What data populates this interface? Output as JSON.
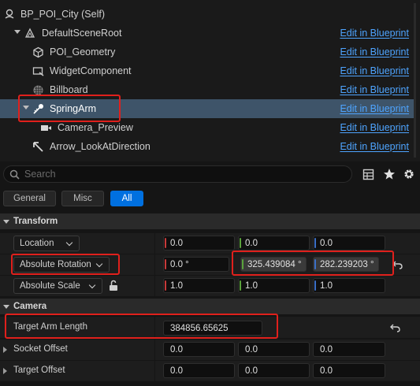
{
  "tree": {
    "root": "BP_POI_City (Self)",
    "edit_label": "Edit in Blueprint",
    "items": [
      {
        "label": "DefaultSceneRoot",
        "edit": "Edit in Blueprint"
      },
      {
        "label": "POI_Geometry",
        "edit": "Edit in Blueprint"
      },
      {
        "label": "WidgetComponent",
        "edit": "Edit in Blueprint"
      },
      {
        "label": "Billboard",
        "edit": "Edit in Blueprint"
      },
      {
        "label": "SpringArm",
        "edit": "Edit in Blueprint"
      },
      {
        "label": "Camera_Preview",
        "edit": "Edit in Blueprint"
      },
      {
        "label": "Arrow_LookAtDirection",
        "edit": "Edit in Blueprint"
      }
    ]
  },
  "search": {
    "placeholder": "Search"
  },
  "filters": {
    "general": "General",
    "misc": "Misc",
    "all": "All",
    "active": "All"
  },
  "transform": {
    "title": "Transform",
    "location": {
      "label": "Location",
      "x": "0.0",
      "y": "0.0",
      "z": "0.0"
    },
    "rotation": {
      "label": "Absolute Rotation",
      "x": "0.0 °",
      "y": "325.439084 °",
      "z": "282.239203 °"
    },
    "scale": {
      "label": "Absolute Scale",
      "x": "1.0",
      "y": "1.0",
      "z": "1.0"
    }
  },
  "camera": {
    "title": "Camera",
    "target_arm_length": {
      "label": "Target Arm Length",
      "value": "384856.65625"
    },
    "socket_offset": {
      "label": "Socket Offset",
      "x": "0.0",
      "y": "0.0",
      "z": "0.0"
    },
    "target_offset": {
      "label": "Target Offset",
      "x": "0.0",
      "y": "0.0",
      "z": "0.0"
    }
  },
  "colors": {
    "accent": "#0070e0",
    "link": "#4ea4ff",
    "selection": "#3e5469",
    "highlight": "#e0201c"
  }
}
